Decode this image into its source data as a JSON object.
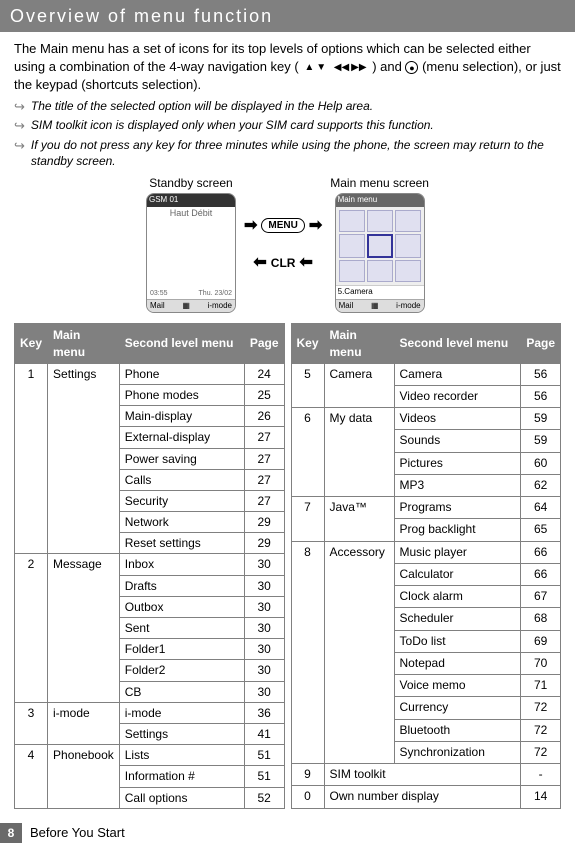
{
  "header": {
    "title": "Overview of menu function"
  },
  "intro": {
    "text_before_glyphs": "The Main menu has a set of icons for its top levels of options which can be selected either using a combination of the 4-way navigation key (",
    "text_between": " ) and ",
    "text_after": " (menu selection), or just the keypad (shortcuts selection)."
  },
  "notes": {
    "n1": "The title of the selected option will be displayed in the Help area.",
    "n2": "SIM toolkit icon is displayed only when your SIM card supports this function.",
    "n3": "If you do not press any key for three minutes while using the phone, the screen may return to the standby screen."
  },
  "screens": {
    "standby_caption": "Standby screen",
    "mainmenu_caption": "Main menu screen",
    "standby_status": "GSM 01",
    "standby_body": "Haut Débit",
    "standby_time": "03:55",
    "standby_date": "Thu. 23/02",
    "sk_mail": "Mail",
    "sk_imode": "i-mode",
    "mm_title": "Main menu",
    "mm_selected": "5.Camera",
    "btn_menu": "MENU",
    "btn_clr": "CLR"
  },
  "table": {
    "headers": {
      "key": "Key",
      "main": "Main menu",
      "second": "Second level menu",
      "page": "Page"
    },
    "left": [
      {
        "key": "1",
        "main": "Settings",
        "rows": [
          {
            "second": "Phone",
            "page": "24"
          },
          {
            "second": "Phone modes",
            "page": "25"
          },
          {
            "second": "Main-display",
            "page": "26"
          },
          {
            "second": "External-display",
            "page": "27"
          },
          {
            "second": "Power saving",
            "page": "27"
          },
          {
            "second": "Calls",
            "page": "27"
          },
          {
            "second": "Security",
            "page": "27"
          },
          {
            "second": "Network",
            "page": "29"
          },
          {
            "second": "Reset settings",
            "page": "29"
          }
        ]
      },
      {
        "key": "2",
        "main": "Message",
        "rows": [
          {
            "second": "Inbox",
            "page": "30"
          },
          {
            "second": "Drafts",
            "page": "30"
          },
          {
            "second": "Outbox",
            "page": "30"
          },
          {
            "second": "Sent",
            "page": "30"
          },
          {
            "second": "Folder1",
            "page": "30"
          },
          {
            "second": "Folder2",
            "page": "30"
          },
          {
            "second": "CB",
            "page": "30"
          }
        ]
      },
      {
        "key": "3",
        "main": "i-mode",
        "rows": [
          {
            "second": "i-mode",
            "page": "36"
          },
          {
            "second": "Settings",
            "page": "41"
          }
        ]
      },
      {
        "key": "4",
        "main": "Phonebook",
        "rows": [
          {
            "second": "Lists",
            "page": "51"
          },
          {
            "second": "Information #",
            "page": "51"
          },
          {
            "second": "Call options",
            "page": "52"
          }
        ]
      }
    ],
    "right": [
      {
        "key": "5",
        "main": "Camera",
        "rows": [
          {
            "second": "Camera",
            "page": "56"
          },
          {
            "second": "Video recorder",
            "page": "56"
          }
        ]
      },
      {
        "key": "6",
        "main": "My data",
        "rows": [
          {
            "second": "Videos",
            "page": "59"
          },
          {
            "second": "Sounds",
            "page": "59"
          },
          {
            "second": "Pictures",
            "page": "60"
          },
          {
            "second": "MP3",
            "page": "62"
          }
        ]
      },
      {
        "key": "7",
        "main": "Java™",
        "rows": [
          {
            "second": "Programs",
            "page": "64"
          },
          {
            "second": "Prog backlight",
            "page": "65"
          }
        ]
      },
      {
        "key": "8",
        "main": "Accessory",
        "rows": [
          {
            "second": "Music player",
            "page": "66"
          },
          {
            "second": "Calculator",
            "page": "66"
          },
          {
            "second": "Clock alarm",
            "page": "67"
          },
          {
            "second": "Scheduler",
            "page": "68"
          },
          {
            "second": "ToDo list",
            "page": "69"
          },
          {
            "second": "Notepad",
            "page": "70"
          },
          {
            "second": "Voice memo",
            "page": "71"
          },
          {
            "second": "Currency",
            "page": "72"
          },
          {
            "second": "Bluetooth",
            "page": "72"
          },
          {
            "second": "Synchronization",
            "page": "72"
          }
        ]
      },
      {
        "key": "9",
        "main_span": "SIM toolkit",
        "page": "-"
      },
      {
        "key": "0",
        "main_span": "Own number display",
        "page": "14"
      }
    ]
  },
  "footer": {
    "page_number": "8",
    "section": "Before You Start"
  }
}
